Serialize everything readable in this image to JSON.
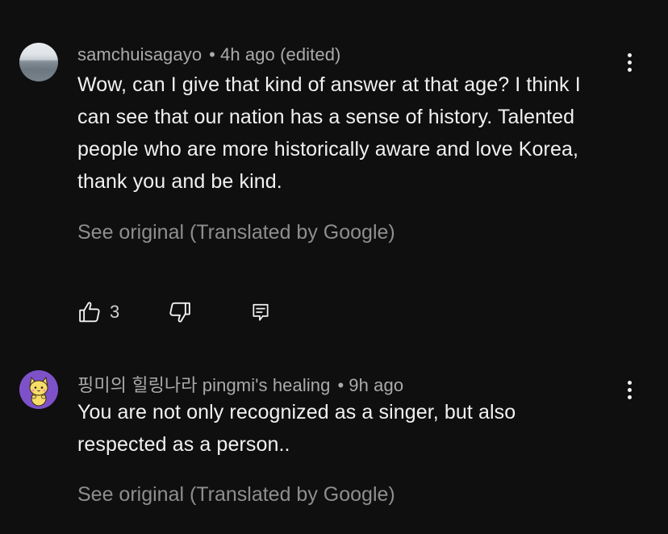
{
  "comments": [
    {
      "author": "samchuisagayo",
      "separator": "•",
      "time": "4h ago (edited)",
      "text": "Wow, can I give that kind of answer at that age? I think I can see that our nation has a sense of history. Talented people who are more historically aware and love Korea, thank you and be kind.",
      "see_original": "See original (Translated by Google)",
      "likes": "3",
      "avatar_icon": "sea-horizon-avatar"
    },
    {
      "author": "핑미의 힐링나라 pingmi's healing",
      "separator": "•",
      "time": "9h ago",
      "text": "You are not only recognized as a singer, but also respected as a person..",
      "see_original": "See original (Translated by Google)",
      "avatar_icon": "cat-avatar"
    }
  ],
  "colors": {
    "background": "#0f0f0f",
    "text_primary": "#f1f1f1",
    "text_secondary": "#aaaaaa",
    "text_muted": "#8e8e8e",
    "cat_avatar_bg": "#7d52c9"
  },
  "icons": {
    "like": "thumbs-up-icon",
    "dislike": "thumbs-down-icon",
    "reply": "comment-reply-icon",
    "more": "more-vertical-icon"
  }
}
